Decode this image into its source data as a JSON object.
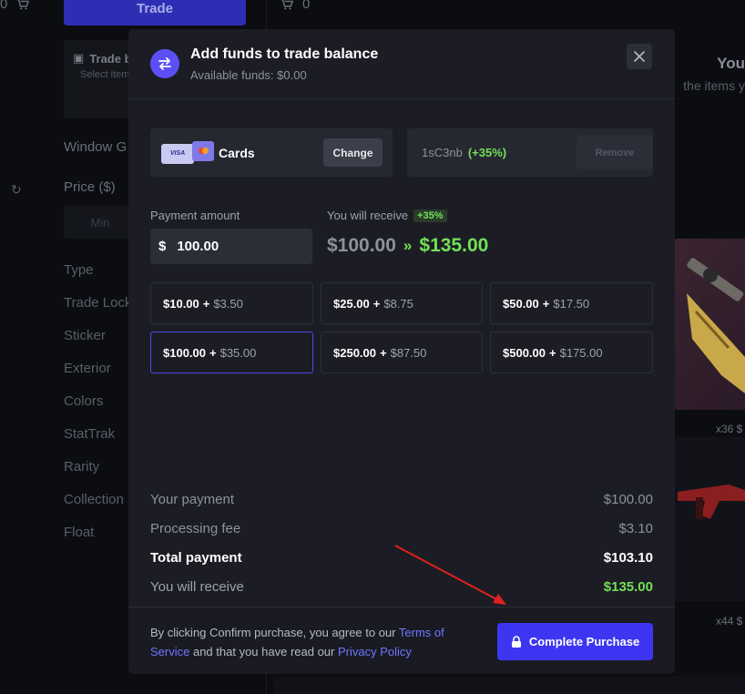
{
  "background": {
    "left_count": "0",
    "trade_button": "Trade",
    "cart_count": "0",
    "trade_box_title": "Trade b",
    "trade_box_sub": "Select item",
    "window_title": "Window G",
    "price_title": "Price ($)",
    "min_placeholder": "Min",
    "filters": [
      "Type",
      "Trade Lock",
      "Sticker",
      "Exterior",
      "Colors",
      "StatTrak",
      "Rarity",
      "Collection",
      "Float"
    ],
    "right_title": "You",
    "right_sub": "the items y",
    "item_count_1": "x36 $",
    "item_count_2": "x44 $"
  },
  "modal": {
    "title": "Add funds to trade balance",
    "subtitle": "Available funds: $0.00",
    "payment_method": {
      "label": "Cards",
      "visa_text": "VISA",
      "change_label": "Change"
    },
    "promo": {
      "code": "1sC3nb",
      "bonus": "(+35%)",
      "remove_label": "Remove"
    },
    "amount": {
      "label": "Payment amount",
      "currency": "$",
      "value": "100.00"
    },
    "receive": {
      "label": "You will receive",
      "bonus": "+35%",
      "from": "$100.00",
      "arrow": "»",
      "to": "$135.00"
    },
    "presets": [
      {
        "amount": "$10.00",
        "bonus": "$3.50",
        "active": false
      },
      {
        "amount": "$25.00",
        "bonus": "$8.75",
        "active": false
      },
      {
        "amount": "$50.00",
        "bonus": "$17.50",
        "active": false
      },
      {
        "amount": "$100.00",
        "bonus": "$35.00",
        "active": true
      },
      {
        "amount": "$250.00",
        "bonus": "$87.50",
        "active": false
      },
      {
        "amount": "$500.00",
        "bonus": "$175.00",
        "active": false
      }
    ],
    "summary": {
      "your_payment_label": "Your payment",
      "your_payment_value": "$100.00",
      "fee_label": "Processing fee",
      "fee_value": "$3.10",
      "total_label": "Total payment",
      "total_value": "$103.10",
      "receive_label": "You will receive",
      "receive_value": "$135.00"
    },
    "footer": {
      "text_1": "By clicking Confirm purchase, you agree to our ",
      "terms_link": "Terms of Service",
      "text_2": " and that you have read our ",
      "privacy_link": "Privacy Policy",
      "button_label": "Complete Purchase"
    }
  },
  "colors": {
    "accent": "#3d35f2",
    "bonus_green": "#72e057",
    "modal_bg": "#1c1d24",
    "annotation_arrow": "#e0201e"
  }
}
